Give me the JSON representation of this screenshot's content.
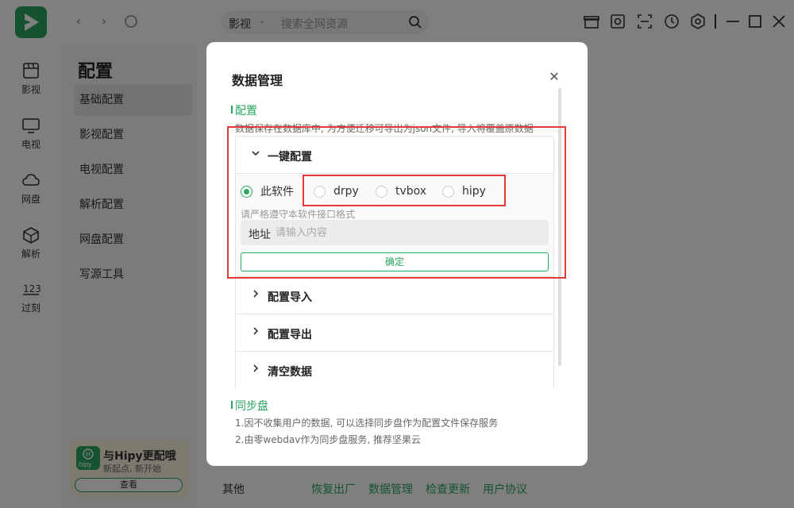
{
  "nav": {
    "items": [
      {
        "label": "影视",
        "icon": "film-icon"
      },
      {
        "label": "电视",
        "icon": "tv-icon"
      },
      {
        "label": "网盘",
        "icon": "cloud-icon"
      },
      {
        "label": "解析",
        "icon": "cube-icon"
      },
      {
        "label": "过刻",
        "icon": "numbers-icon"
      }
    ]
  },
  "topbar": {
    "search_category": "影视",
    "search_placeholder": "搜索全网资源"
  },
  "settings": {
    "title": "配置",
    "items": [
      "基础配置",
      "影视配置",
      "电视配置",
      "解析配置",
      "网盘配置",
      "写源工具"
    ],
    "active_index": 0
  },
  "promo": {
    "logo_text": "hipy",
    "title": "与Hipy更配哦",
    "subtitle": "新起点, 新开始",
    "button": "查看"
  },
  "main_bottom": {
    "label": "其他",
    "links": [
      "恢复出厂",
      "数据管理",
      "检查更新",
      "用户协议"
    ]
  },
  "modal": {
    "title": "数据管理",
    "config_section": {
      "heading": "配置",
      "description": "数据保存在数据库中, 为方便迁移可导出为json文件, 导入将覆盖原数据"
    },
    "collapse": {
      "open_label": "一键配置",
      "radios": [
        {
          "label": "此软件",
          "checked": true
        },
        {
          "label": "drpy",
          "checked": false
        },
        {
          "label": "tvbox",
          "checked": false
        },
        {
          "label": "hipy",
          "checked": false
        }
      ],
      "hint": "请严格遵守本软件接口格式",
      "address_label": "地址",
      "address_placeholder": "请输入内容",
      "confirm_label": "确定",
      "other_items": [
        "配置导入",
        "配置导出",
        "清空数据"
      ]
    },
    "sync_section": {
      "heading": "同步盘",
      "line1": "1.因不收集用户的数据, 可以选择同步盘作为配置文件保存服务",
      "line2": "2.由零webdav作为同步盘服务, 推荐坚果云"
    }
  },
  "colors": {
    "accent": "#2aa760",
    "annotation": "#e03a3a"
  }
}
